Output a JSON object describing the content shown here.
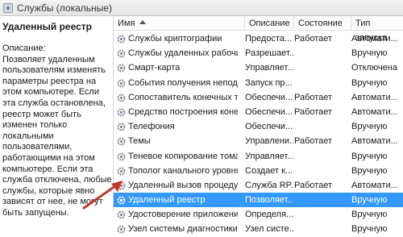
{
  "window": {
    "title": "Службы (локальные)",
    "title_icon": "services-icon"
  },
  "left_panel": {
    "title": "Удаленный реестр",
    "description_label": "Описание:",
    "description": "Позволяет удаленным пользователям изменять параметры реестра на этом компьютере. Если эта служба остановлена, реестр может быть изменен только локальными пользователями, работающими на этом компьютере. Если эта служба отключена, любые службы, которые явно зависят от нее, не могут быть запущены."
  },
  "table": {
    "columns": [
      "Имя",
      "Описание",
      "Состояние",
      "Тип запуска"
    ],
    "sort_indicator": "sort-ascending-icon",
    "selected_row": "Удаленный реестр",
    "selection_color": "#3399ff",
    "rows": [
      {
        "name": "Службы криптографии",
        "desc": "Предоста...",
        "state": "Работает",
        "type": "Автомати..."
      },
      {
        "name": "Службы удаленных рабочих...",
        "desc": "Разрешает...",
        "state": "",
        "type": "Вручную"
      },
      {
        "name": "Смарт-карта",
        "desc": "Управляет...",
        "state": "",
        "type": "Отключена"
      },
      {
        "name": "События получения неподв...",
        "desc": "Запуск пр...",
        "state": "",
        "type": "Вручную"
      },
      {
        "name": "Сопоставитель конечных т...",
        "desc": "Обеспечи...",
        "state": "Работает",
        "type": "Автомати..."
      },
      {
        "name": "Средство построения коне...",
        "desc": "Обеспечи...",
        "state": "Работает",
        "type": "Автомати..."
      },
      {
        "name": "Телефония",
        "desc": "Обеспечи...",
        "state": "",
        "type": "Вручную"
      },
      {
        "name": "Темы",
        "desc": "Управлени...",
        "state": "Работает",
        "type": "Автомати..."
      },
      {
        "name": "Теневое копирование тома",
        "desc": "Управляет...",
        "state": "",
        "type": "Вручную"
      },
      {
        "name": "Тополог канального уровня",
        "desc": "Создает к...",
        "state": "",
        "type": "Вручную"
      },
      {
        "name": "Удаленный вызов процеду...",
        "desc": "Служба RP...",
        "state": "Работает",
        "type": "Автомати..."
      },
      {
        "name": "Удаленный реестр",
        "desc": "Позволяет...",
        "state": "",
        "type": "Вручную"
      },
      {
        "name": "Удостоверение приложения",
        "desc": "Определя...",
        "state": "",
        "type": "Вручную"
      },
      {
        "name": "Узел системы диагностики",
        "desc": "Узел систе...",
        "state": "",
        "type": "Вручную"
      }
    ]
  },
  "annotation": {
    "arrow_color": "#c0392b"
  }
}
